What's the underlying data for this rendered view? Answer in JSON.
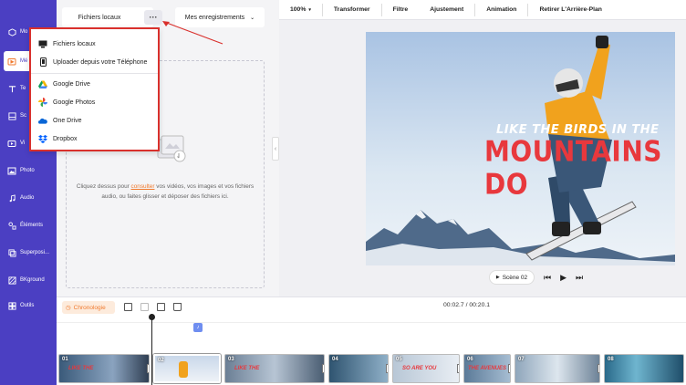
{
  "sidebar": {
    "items": [
      {
        "label": "Mo",
        "icon": "cube-icon"
      },
      {
        "label": "Mé",
        "icon": "media-folder-icon",
        "active": true
      },
      {
        "label": "Te",
        "icon": "text-icon"
      },
      {
        "label": "Sc",
        "icon": "scene-icon"
      },
      {
        "label": "Vi",
        "icon": "video-icon"
      },
      {
        "label": "Photo",
        "icon": "photo-icon"
      },
      {
        "label": "Audio",
        "icon": "music-note-icon"
      },
      {
        "label": "Éléments",
        "icon": "elements-icon"
      },
      {
        "label": "Superposi...",
        "icon": "overlay-icon"
      },
      {
        "label": "BKground",
        "icon": "background-icon"
      },
      {
        "label": "Outils",
        "icon": "tools-icon"
      }
    ]
  },
  "panel": {
    "tab_local": "Fichiers locaux",
    "tab_more": "···",
    "tab_saved": "Mes enregistrements",
    "drop_text_1": "Cliquez dessus pour ",
    "drop_link": "consulter",
    "drop_text_2": " vos vidéos, vos images et vos fichiers audio, ou faites glisser et déposer des fichiers ici."
  },
  "dropdown": {
    "items": [
      {
        "label": "Fichiers locaux",
        "icon": "monitor-icon"
      },
      {
        "label": "Uploader depuis votre Téléphone",
        "icon": "phone-icon"
      },
      {
        "label": "Google Drive",
        "icon": "google-drive-icon"
      },
      {
        "label": "Google Photos",
        "icon": "google-photos-icon"
      },
      {
        "label": "One Drive",
        "icon": "onedrive-icon"
      },
      {
        "label": "Dropbox",
        "icon": "dropbox-icon"
      }
    ]
  },
  "toolbar": {
    "zoom": "100%",
    "transform": "Transformer",
    "filter": "Filtre",
    "adjust": "Ajustement",
    "animation": "Animation",
    "remove_bg": "Retirer L'Arrière-Plan"
  },
  "canvas": {
    "headline_1": "LIKE THE BIRDS IN THE",
    "headline_2": "MOUNTAINS DO"
  },
  "playback": {
    "scene_label": "Scène 02"
  },
  "timeline": {
    "chrono_label": "Chronologie",
    "timecode": "00:02.7 / 00:20.1",
    "clips": [
      {
        "num": "01",
        "caption": "LIKE THE"
      },
      {
        "num": "02",
        "caption": ""
      },
      {
        "num": "03",
        "caption": "LIKE THE"
      },
      {
        "num": "04",
        "caption": ""
      },
      {
        "num": "05",
        "caption": "SO ARE YOU"
      },
      {
        "num": "06",
        "caption": "THE AVENUES"
      },
      {
        "num": "07",
        "caption": ""
      },
      {
        "num": "08",
        "caption": ""
      }
    ]
  },
  "colors": {
    "sidebar": "#4b3fc2",
    "accent": "#f07a2e",
    "highlight": "#d9302c",
    "headline_red": "#e8383d"
  }
}
